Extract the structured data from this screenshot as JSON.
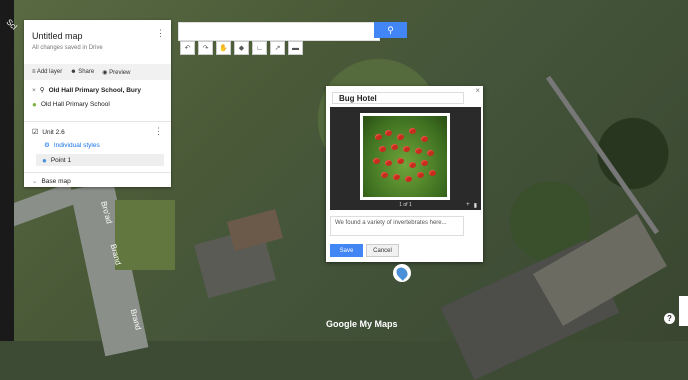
{
  "search": {
    "placeholder": ""
  },
  "panel": {
    "title": "Untitled map",
    "subtitle": "All changes saved in Drive",
    "actions": [
      "Add layer",
      "Share",
      "Preview"
    ],
    "search_query": "Old Hall Primary School, Bury",
    "result": "Old Hall Primary School",
    "layer_name": "Unit 2.6",
    "layer_style": "Individual styles",
    "point": "Point 1",
    "base_map": "Base map"
  },
  "popup": {
    "title": "Bug Hotel",
    "photo_caption": "1 of 1",
    "description": "We found a variety of invertebrates here...",
    "save": "Save",
    "cancel": "Cancel"
  },
  "map": {
    "logo": "Google My Maps",
    "street_1": "Bro'ad",
    "street_2": "Brand",
    "corner_label": "Scl",
    "help": "?"
  },
  "icons": {
    "search": "search-icon",
    "pin": "map-pin-icon"
  },
  "colors": {
    "accent": "#4285f4",
    "point_marker": "#4a90d9",
    "green_marker": "#7cb342"
  }
}
